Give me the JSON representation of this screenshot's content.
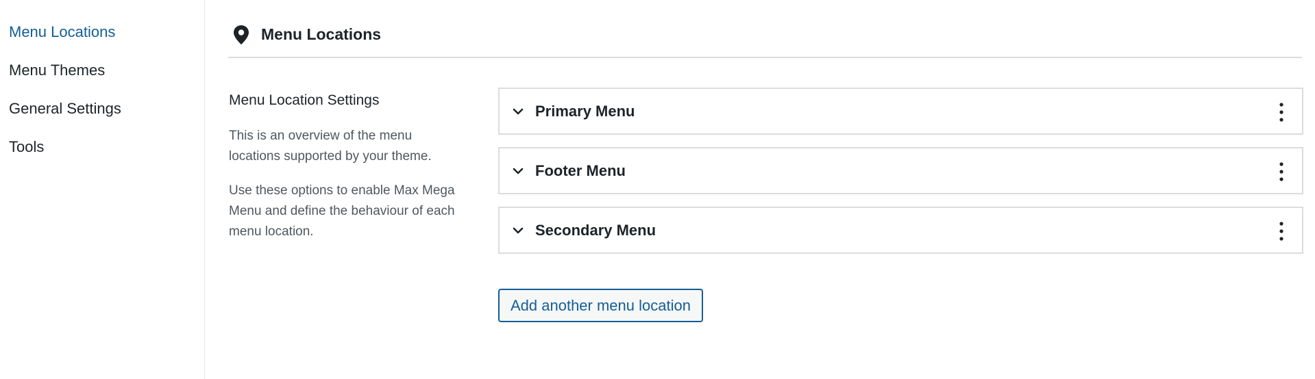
{
  "sidebar": {
    "items": [
      {
        "label": "Menu Locations",
        "active": true
      },
      {
        "label": "Menu Themes",
        "active": false
      },
      {
        "label": "General Settings",
        "active": false
      },
      {
        "label": "Tools",
        "active": false
      }
    ]
  },
  "header": {
    "icon": "location-pin-icon",
    "title": "Menu Locations"
  },
  "settings": {
    "heading": "Menu Location Settings",
    "description_1": "This is an overview of the menu locations supported by your theme.",
    "description_2": "Use these options to enable Max Mega Menu and define the behaviour of each menu location."
  },
  "locations": [
    {
      "name": "Primary Menu",
      "expand_icon": "chevron-down-icon",
      "actions_icon": "more-vertical-icon"
    },
    {
      "name": "Footer Menu",
      "expand_icon": "chevron-down-icon",
      "actions_icon": "more-vertical-icon"
    },
    {
      "name": "Secondary Menu",
      "expand_icon": "chevron-down-icon",
      "actions_icon": "more-vertical-icon"
    }
  ],
  "add_button": {
    "label": "Add another menu location"
  },
  "colors": {
    "accent": "#135e96",
    "text": "#1d2327",
    "muted_text": "#50575e",
    "border": "#dcdcde"
  }
}
